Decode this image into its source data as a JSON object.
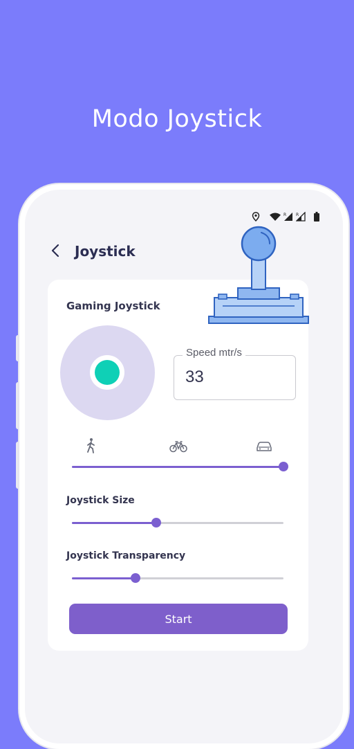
{
  "promo": {
    "title": "Modo Joystick"
  },
  "header": {
    "title": "Joystick"
  },
  "card": {
    "title": "Gaming Joystick",
    "speed": {
      "label": "Speed mtr/s",
      "value": "33"
    },
    "modes": [
      {
        "icon": "walk-icon"
      },
      {
        "icon": "bicycle-icon"
      },
      {
        "icon": "car-icon"
      }
    ],
    "speed_mode_slider": {
      "value": 1.0
    },
    "size": {
      "label": "Joystick Size",
      "value": 0.4
    },
    "transparency": {
      "label": "Joystick Transparency",
      "value": 0.3
    },
    "start_label": "Start"
  },
  "colors": {
    "background": "#7b7cfb",
    "accent": "#7b5fd0",
    "knob": "#0fd0b6",
    "pad": "#dcd8f1"
  }
}
